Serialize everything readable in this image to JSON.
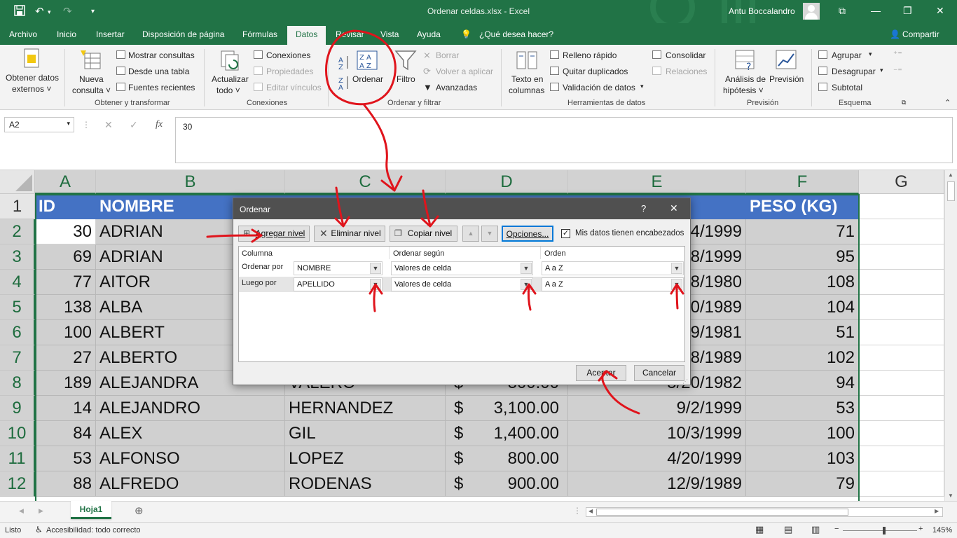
{
  "window": {
    "title": "Ordenar celdas.xlsx  -  Excel",
    "user": "Antu Boccalandro"
  },
  "tabs": [
    "Archivo",
    "Inicio",
    "Insertar",
    "Disposición de página",
    "Fórmulas",
    "Datos",
    "Revisar",
    "Vista",
    "Ayuda"
  ],
  "tell_me": "¿Qué desea hacer?",
  "share": "Compartir",
  "ribbon": {
    "obtener_datos_1": "Obtener datos",
    "obtener_datos_2": "externos ˅",
    "nueva_consulta_1": "Nueva",
    "nueva_consulta_2": "consulta ˅",
    "mostrar_consultas": "Mostrar consultas",
    "desde_tabla": "Desde una tabla",
    "fuentes_recientes": "Fuentes recientes",
    "grp_obtener": "Obtener y transformar",
    "actualizar_1": "Actualizar",
    "actualizar_2": "todo ˅",
    "conexiones": "Conexiones",
    "propiedades": "Propiedades",
    "editar_vinculos": "Editar vínculos",
    "grp_conexiones": "Conexiones",
    "ordenar": "Ordenar",
    "filtro": "Filtro",
    "borrar": "Borrar",
    "volver_aplicar": "Volver a aplicar",
    "avanzadas": "Avanzadas",
    "grp_ordenar": "Ordenar y filtrar",
    "texto_columnas_1": "Texto en",
    "texto_columnas_2": "columnas",
    "relleno_rapido": "Relleno rápido",
    "quitar_duplicados": "Quitar duplicados",
    "validacion": "Validación de datos",
    "consolidar": "Consolidar",
    "relaciones": "Relaciones",
    "grp_herramientas": "Herramientas de datos",
    "analisis_1": "Análisis de",
    "analisis_2": "hipótesis ˅",
    "prevision": "Previsión",
    "grp_prevision": "Previsión",
    "agrupar": "Agrupar",
    "desagrupar": "Desagrupar",
    "subtotal": "Subtotal",
    "grp_esquema": "Esquema"
  },
  "formula_bar": {
    "name_box": "A2",
    "formula": "30"
  },
  "columns": [
    "A",
    "B",
    "C",
    "D",
    "E",
    "F",
    "G"
  ],
  "rows": [
    "1",
    "2",
    "3",
    "4",
    "5",
    "6",
    "7",
    "8",
    "9",
    "10",
    "11",
    "12"
  ],
  "header_row": [
    "ID",
    "NOMBRE",
    "",
    "",
    "ENTO",
    "PESO (KG)"
  ],
  "data_rows": [
    [
      "30",
      "ADRIAN",
      "",
      "",
      "",
      "4/1999",
      "71"
    ],
    [
      "69",
      "ADRIAN",
      "",
      "",
      "",
      "8/1999",
      "95"
    ],
    [
      "77",
      "AITOR",
      "",
      "",
      "",
      "8/1980",
      "108"
    ],
    [
      "138",
      "ALBA",
      "",
      "",
      "",
      "0/1989",
      "104"
    ],
    [
      "100",
      "ALBERT",
      "",
      "",
      "",
      "9/1981",
      "51"
    ],
    [
      "27",
      "ALBERTO",
      "",
      "",
      "",
      "8/1989",
      "102"
    ],
    [
      "189",
      "ALEJANDRA",
      "VALERO",
      "$",
      "300.00",
      "5/20/1982",
      "94"
    ],
    [
      "14",
      "ALEJANDRO",
      "HERNANDEZ",
      "$",
      "3,100.00",
      "9/2/1999",
      "53"
    ],
    [
      "84",
      "ALEX",
      "GIL",
      "$",
      "1,400.00",
      "10/3/1999",
      "100"
    ],
    [
      "53",
      "ALFONSO",
      "LOPEZ",
      "$",
      "800.00",
      "4/20/1999",
      "103"
    ],
    [
      "88",
      "ALFREDO",
      "RODENAS",
      "$",
      "900.00",
      "12/9/1989",
      "79"
    ]
  ],
  "sheet_tab": "Hoja1",
  "status": {
    "ready": "Listo",
    "accessibility": "Accesibilidad: todo correcto",
    "zoom": "145%"
  },
  "dialog": {
    "title": "Ordenar",
    "help": "?",
    "close": "✕",
    "agregar_nivel": "Agregar nivel",
    "eliminar_nivel": "Eliminar nivel",
    "copiar_nivel": "Copiar nivel",
    "opciones": "Opciones...",
    "encabezados": "Mis datos tienen encabezados",
    "col_header": "Columna",
    "sort_on_header": "Ordenar según",
    "order_header": "Orden",
    "levels": [
      {
        "label": "Ordenar por",
        "column": "NOMBRE",
        "sort_on": "Valores de celda",
        "order": "A a Z"
      },
      {
        "label": "Luego por",
        "column": "APELLIDO",
        "sort_on": "Valores de celda",
        "order": "A a Z"
      }
    ],
    "aceptar": "Aceptar",
    "cancelar": "Cancelar"
  },
  "colors": {
    "excel_green": "#217346",
    "table_header": "#4472c4",
    "annotation_red": "#e0141c"
  }
}
